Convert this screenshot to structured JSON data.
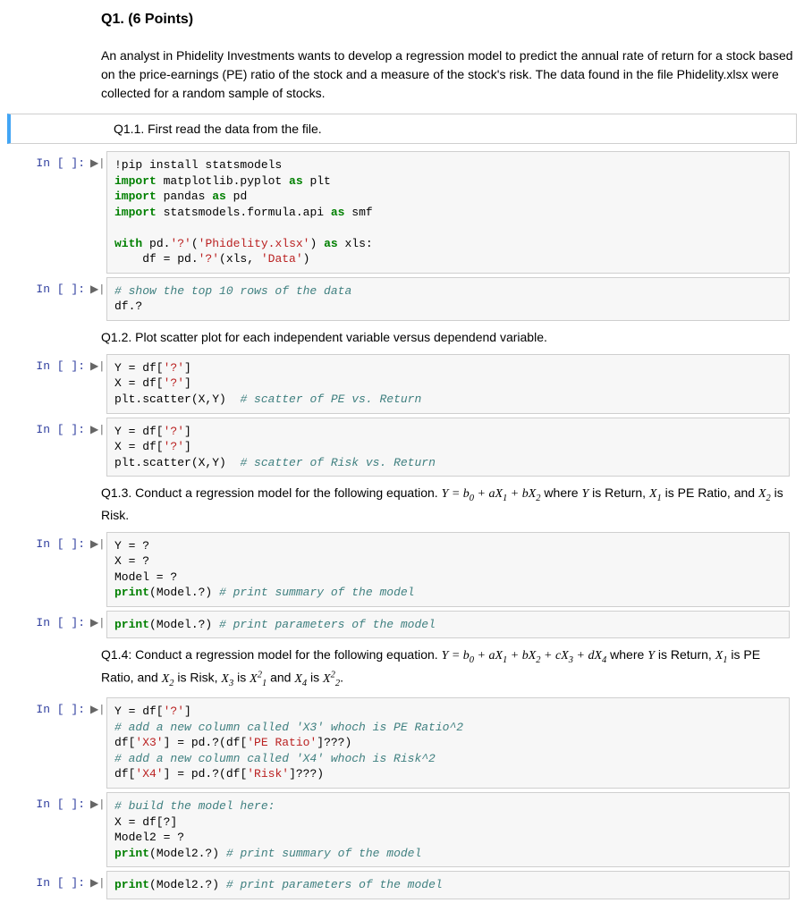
{
  "heading": "Q1. (6 Points)",
  "intro": "An analyst in Phidelity Investments wants to develop a regression model to predict the annual rate of return for a stock based on the price-earnings (PE) ratio of the stock and a measure of the stock's risk. The data found in the file Phidelity.xlsx were collected for a random sample of stocks.",
  "q11": "Q1.1. First read the data from the file.",
  "q12": "Q1.2. Plot scatter plot for each independent variable versus dependend variable.",
  "q13_pre": "Q1.3. Conduct a regression model for the following equation. ",
  "q13_post": " is Risk.",
  "q14_pre": "Q1.4: Conduct a regression model for the following equation. ",
  "q14_mid": " is Risk, ",
  "prompt_label": "In [ ]:",
  "run_glyph": "▶|",
  "cells": {
    "c1": {
      "l1a": "!pip install statsmodels",
      "l2a": "import",
      "l2b": " matplotlib.pyplot ",
      "l2c": "as",
      "l2d": " plt",
      "l3a": "import",
      "l3b": " pandas ",
      "l3c": "as",
      "l3d": " pd",
      "l4a": "import",
      "l4b": " statsmodels.formula.api ",
      "l4c": "as",
      "l4d": " smf",
      "l6a": "with",
      "l6b": " pd.",
      "l6c": "'?'",
      "l6d": "(",
      "l6e": "'Phidelity.xlsx'",
      "l6f": ") ",
      "l6g": "as",
      "l6h": " xls:",
      "l7a": "    df = pd.",
      "l7b": "'?'",
      "l7c": "(xls, ",
      "l7d": "'Data'",
      "l7e": ")"
    },
    "c2": {
      "l1": "# show the top 10 rows of the data",
      "l2": "df.?"
    },
    "c3": {
      "l1a": "Y = df[",
      "l1b": "'?'",
      "l1c": "]",
      "l2a": "X = df[",
      "l2b": "'?'",
      "l2c": "]",
      "l3a": "plt.scatter(X,Y)  ",
      "l3b": "# scatter of PE vs. Return"
    },
    "c4": {
      "l1a": "Y = df[",
      "l1b": "'?'",
      "l1c": "]",
      "l2a": "X = df[",
      "l2b": "'?'",
      "l2c": "]",
      "l3a": "plt.scatter(X,Y)  ",
      "l3b": "# scatter of Risk vs. Return"
    },
    "c5": {
      "l1": "Y = ?",
      "l2": "X = ?",
      "l3": "Model = ?",
      "l4a": "print",
      "l4b": "(Model.?) ",
      "l4c": "# print summary of the model"
    },
    "c6": {
      "l1a": "print",
      "l1b": "(Model.?) ",
      "l1c": "# print parameters of the model"
    },
    "c7": {
      "l1a": "Y = df[",
      "l1b": "'?'",
      "l1c": "]",
      "l2": "# add a new column called 'X3' whoch is PE Ratio^2",
      "l3a": "df[",
      "l3b": "'X3'",
      "l3c": "] = pd.?(df[",
      "l3d": "'PE Ratio'",
      "l3e": "]???)",
      "l4": "# add a new column called 'X4' whoch is Risk^2",
      "l5a": "df[",
      "l5b": "'X4'",
      "l5c": "] = pd.?(df[",
      "l5d": "'Risk'",
      "l5e": "]???)"
    },
    "c8": {
      "l1": "# build the model here:",
      "l2": "X = df[?]",
      "l3": "Model2 = ?",
      "l4a": "print",
      "l4b": "(Model2.?) ",
      "l4c": "# print summary of the model"
    },
    "c9": {
      "l1a": "print",
      "l1b": "(Model2.?) ",
      "l1c": "# print parameters of the model"
    }
  }
}
